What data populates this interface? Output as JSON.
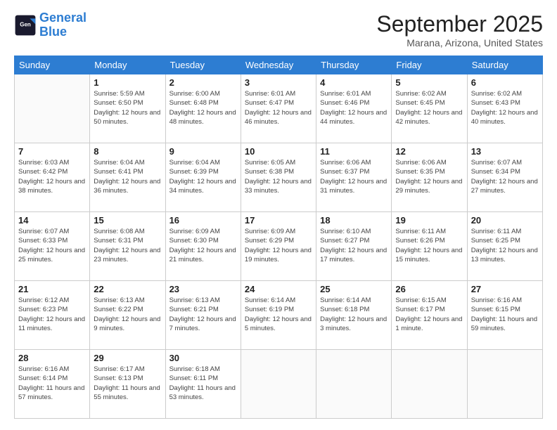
{
  "logo": {
    "line1": "General",
    "line2": "Blue"
  },
  "title": "September 2025",
  "location": "Marana, Arizona, United States",
  "days_header": [
    "Sunday",
    "Monday",
    "Tuesday",
    "Wednesday",
    "Thursday",
    "Friday",
    "Saturday"
  ],
  "weeks": [
    [
      {
        "num": "",
        "sunrise": "",
        "sunset": "",
        "daylight": ""
      },
      {
        "num": "1",
        "sunrise": "Sunrise: 5:59 AM",
        "sunset": "Sunset: 6:50 PM",
        "daylight": "Daylight: 12 hours and 50 minutes."
      },
      {
        "num": "2",
        "sunrise": "Sunrise: 6:00 AM",
        "sunset": "Sunset: 6:48 PM",
        "daylight": "Daylight: 12 hours and 48 minutes."
      },
      {
        "num": "3",
        "sunrise": "Sunrise: 6:01 AM",
        "sunset": "Sunset: 6:47 PM",
        "daylight": "Daylight: 12 hours and 46 minutes."
      },
      {
        "num": "4",
        "sunrise": "Sunrise: 6:01 AM",
        "sunset": "Sunset: 6:46 PM",
        "daylight": "Daylight: 12 hours and 44 minutes."
      },
      {
        "num": "5",
        "sunrise": "Sunrise: 6:02 AM",
        "sunset": "Sunset: 6:45 PM",
        "daylight": "Daylight: 12 hours and 42 minutes."
      },
      {
        "num": "6",
        "sunrise": "Sunrise: 6:02 AM",
        "sunset": "Sunset: 6:43 PM",
        "daylight": "Daylight: 12 hours and 40 minutes."
      }
    ],
    [
      {
        "num": "7",
        "sunrise": "Sunrise: 6:03 AM",
        "sunset": "Sunset: 6:42 PM",
        "daylight": "Daylight: 12 hours and 38 minutes."
      },
      {
        "num": "8",
        "sunrise": "Sunrise: 6:04 AM",
        "sunset": "Sunset: 6:41 PM",
        "daylight": "Daylight: 12 hours and 36 minutes."
      },
      {
        "num": "9",
        "sunrise": "Sunrise: 6:04 AM",
        "sunset": "Sunset: 6:39 PM",
        "daylight": "Daylight: 12 hours and 34 minutes."
      },
      {
        "num": "10",
        "sunrise": "Sunrise: 6:05 AM",
        "sunset": "Sunset: 6:38 PM",
        "daylight": "Daylight: 12 hours and 33 minutes."
      },
      {
        "num": "11",
        "sunrise": "Sunrise: 6:06 AM",
        "sunset": "Sunset: 6:37 PM",
        "daylight": "Daylight: 12 hours and 31 minutes."
      },
      {
        "num": "12",
        "sunrise": "Sunrise: 6:06 AM",
        "sunset": "Sunset: 6:35 PM",
        "daylight": "Daylight: 12 hours and 29 minutes."
      },
      {
        "num": "13",
        "sunrise": "Sunrise: 6:07 AM",
        "sunset": "Sunset: 6:34 PM",
        "daylight": "Daylight: 12 hours and 27 minutes."
      }
    ],
    [
      {
        "num": "14",
        "sunrise": "Sunrise: 6:07 AM",
        "sunset": "Sunset: 6:33 PM",
        "daylight": "Daylight: 12 hours and 25 minutes."
      },
      {
        "num": "15",
        "sunrise": "Sunrise: 6:08 AM",
        "sunset": "Sunset: 6:31 PM",
        "daylight": "Daylight: 12 hours and 23 minutes."
      },
      {
        "num": "16",
        "sunrise": "Sunrise: 6:09 AM",
        "sunset": "Sunset: 6:30 PM",
        "daylight": "Daylight: 12 hours and 21 minutes."
      },
      {
        "num": "17",
        "sunrise": "Sunrise: 6:09 AM",
        "sunset": "Sunset: 6:29 PM",
        "daylight": "Daylight: 12 hours and 19 minutes."
      },
      {
        "num": "18",
        "sunrise": "Sunrise: 6:10 AM",
        "sunset": "Sunset: 6:27 PM",
        "daylight": "Daylight: 12 hours and 17 minutes."
      },
      {
        "num": "19",
        "sunrise": "Sunrise: 6:11 AM",
        "sunset": "Sunset: 6:26 PM",
        "daylight": "Daylight: 12 hours and 15 minutes."
      },
      {
        "num": "20",
        "sunrise": "Sunrise: 6:11 AM",
        "sunset": "Sunset: 6:25 PM",
        "daylight": "Daylight: 12 hours and 13 minutes."
      }
    ],
    [
      {
        "num": "21",
        "sunrise": "Sunrise: 6:12 AM",
        "sunset": "Sunset: 6:23 PM",
        "daylight": "Daylight: 12 hours and 11 minutes."
      },
      {
        "num": "22",
        "sunrise": "Sunrise: 6:13 AM",
        "sunset": "Sunset: 6:22 PM",
        "daylight": "Daylight: 12 hours and 9 minutes."
      },
      {
        "num": "23",
        "sunrise": "Sunrise: 6:13 AM",
        "sunset": "Sunset: 6:21 PM",
        "daylight": "Daylight: 12 hours and 7 minutes."
      },
      {
        "num": "24",
        "sunrise": "Sunrise: 6:14 AM",
        "sunset": "Sunset: 6:19 PM",
        "daylight": "Daylight: 12 hours and 5 minutes."
      },
      {
        "num": "25",
        "sunrise": "Sunrise: 6:14 AM",
        "sunset": "Sunset: 6:18 PM",
        "daylight": "Daylight: 12 hours and 3 minutes."
      },
      {
        "num": "26",
        "sunrise": "Sunrise: 6:15 AM",
        "sunset": "Sunset: 6:17 PM",
        "daylight": "Daylight: 12 hours and 1 minute."
      },
      {
        "num": "27",
        "sunrise": "Sunrise: 6:16 AM",
        "sunset": "Sunset: 6:15 PM",
        "daylight": "Daylight: 11 hours and 59 minutes."
      }
    ],
    [
      {
        "num": "28",
        "sunrise": "Sunrise: 6:16 AM",
        "sunset": "Sunset: 6:14 PM",
        "daylight": "Daylight: 11 hours and 57 minutes."
      },
      {
        "num": "29",
        "sunrise": "Sunrise: 6:17 AM",
        "sunset": "Sunset: 6:13 PM",
        "daylight": "Daylight: 11 hours and 55 minutes."
      },
      {
        "num": "30",
        "sunrise": "Sunrise: 6:18 AM",
        "sunset": "Sunset: 6:11 PM",
        "daylight": "Daylight: 11 hours and 53 minutes."
      },
      {
        "num": "",
        "sunrise": "",
        "sunset": "",
        "daylight": ""
      },
      {
        "num": "",
        "sunrise": "",
        "sunset": "",
        "daylight": ""
      },
      {
        "num": "",
        "sunrise": "",
        "sunset": "",
        "daylight": ""
      },
      {
        "num": "",
        "sunrise": "",
        "sunset": "",
        "daylight": ""
      }
    ]
  ]
}
